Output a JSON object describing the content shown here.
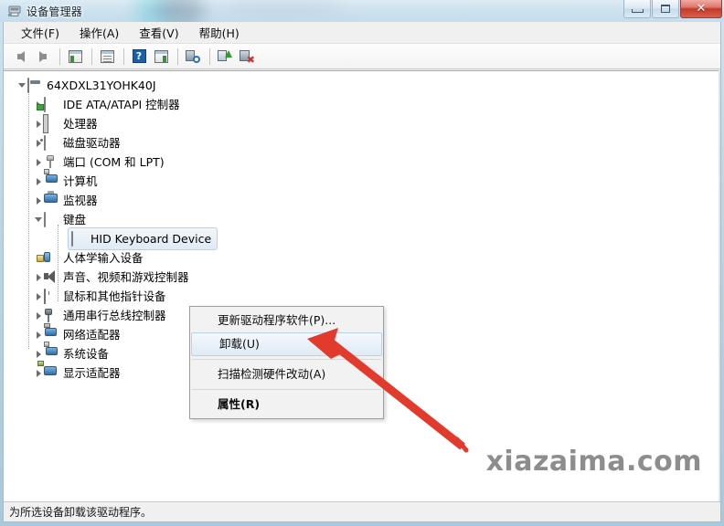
{
  "window": {
    "title": "设备管理器",
    "title_icon": "device-manager-icon",
    "buttons": {
      "minimize": "minimize-button",
      "maximize": "maximize-button",
      "close_glyph": "✕"
    }
  },
  "menubar": {
    "items": [
      {
        "label": "文件(F)",
        "name": "menu-file"
      },
      {
        "label": "操作(A)",
        "name": "menu-action"
      },
      {
        "label": "查看(V)",
        "name": "menu-view"
      },
      {
        "label": "帮助(H)",
        "name": "menu-help"
      }
    ]
  },
  "toolbar": {
    "items": [
      {
        "name": "back-icon",
        "kind": "back"
      },
      {
        "name": "forward-icon",
        "kind": "forward"
      },
      {
        "name": "separator-1",
        "kind": "sep"
      },
      {
        "name": "show-hide-console-tree-icon",
        "kind": "panel-left"
      },
      {
        "name": "properties-icon",
        "kind": "panel-doc"
      },
      {
        "name": "separator-2",
        "kind": "sep"
      },
      {
        "name": "help-icon",
        "kind": "help",
        "glyph": "?"
      },
      {
        "name": "show-hide-action-pane-icon",
        "kind": "panel-right"
      },
      {
        "name": "separator-3",
        "kind": "sep"
      },
      {
        "name": "scan-for-hardware-changes-icon",
        "kind": "scan"
      },
      {
        "name": "separator-4",
        "kind": "sep"
      },
      {
        "name": "update-driver-icon",
        "kind": "update"
      },
      {
        "name": "uninstall-device-icon",
        "kind": "uninstall"
      }
    ]
  },
  "tree": {
    "root": {
      "label": "64XDXL31YOHK40J",
      "icon": "computer-icon",
      "expanded": true
    },
    "nodes": [
      {
        "label": "IDE ATA/ATAPI 控制器",
        "icon": "ide-controller-icon",
        "expanded": false,
        "depth": 1
      },
      {
        "label": "处理器",
        "icon": "processor-icon",
        "expanded": false,
        "depth": 1
      },
      {
        "label": "磁盘驱动器",
        "icon": "disk-drive-icon",
        "expanded": false,
        "depth": 1
      },
      {
        "label": "端口 (COM 和 LPT)",
        "icon": "port-icon",
        "expanded": false,
        "depth": 1
      },
      {
        "label": "计算机",
        "icon": "computer-node-icon",
        "expanded": false,
        "depth": 1
      },
      {
        "label": "监视器",
        "icon": "monitor-icon",
        "expanded": false,
        "depth": 1
      },
      {
        "label": "键盘",
        "icon": "keyboard-icon",
        "expanded": true,
        "depth": 1
      },
      {
        "label": "HID Keyboard Device",
        "icon": "keyboard-device-icon",
        "expanded": null,
        "depth": 2,
        "selected": true
      },
      {
        "label": "人体学输入设备",
        "icon": "hid-input-device-icon",
        "expanded": false,
        "depth": 1
      },
      {
        "label": "声音、视频和游戏控制器",
        "icon": "sound-video-game-icon",
        "expanded": false,
        "depth": 1
      },
      {
        "label": "鼠标和其他指针设备",
        "icon": "mouse-icon",
        "expanded": false,
        "depth": 1
      },
      {
        "label": "通用串行总线控制器",
        "icon": "usb-controller-icon",
        "expanded": false,
        "depth": 1
      },
      {
        "label": "网络适配器",
        "icon": "network-adapter-icon",
        "expanded": false,
        "depth": 1
      },
      {
        "label": "系统设备",
        "icon": "system-device-icon",
        "expanded": false,
        "depth": 1
      },
      {
        "label": "显示适配器",
        "icon": "display-adapter-icon",
        "expanded": false,
        "depth": 1
      }
    ]
  },
  "context_menu": {
    "items": [
      {
        "label": "更新驱动程序软件(P)...",
        "name": "ctx-update-driver",
        "highlight": false,
        "bold": false
      },
      {
        "label": "卸载(U)",
        "name": "ctx-uninstall",
        "highlight": true,
        "bold": false
      },
      {
        "label": "扫描检测硬件改动(A)",
        "name": "ctx-scan-hardware",
        "highlight": false,
        "bold": false
      },
      {
        "label": "属性(R)",
        "name": "ctx-properties",
        "highlight": false,
        "bold": true
      }
    ]
  },
  "annotation": {
    "arrow_color": "#e23b2e",
    "arrow_name": "red-pointer-arrow"
  },
  "watermark": {
    "text": "xiazaima.com"
  },
  "statusbar": {
    "text": "为所选设备卸载该驱动程序。"
  }
}
